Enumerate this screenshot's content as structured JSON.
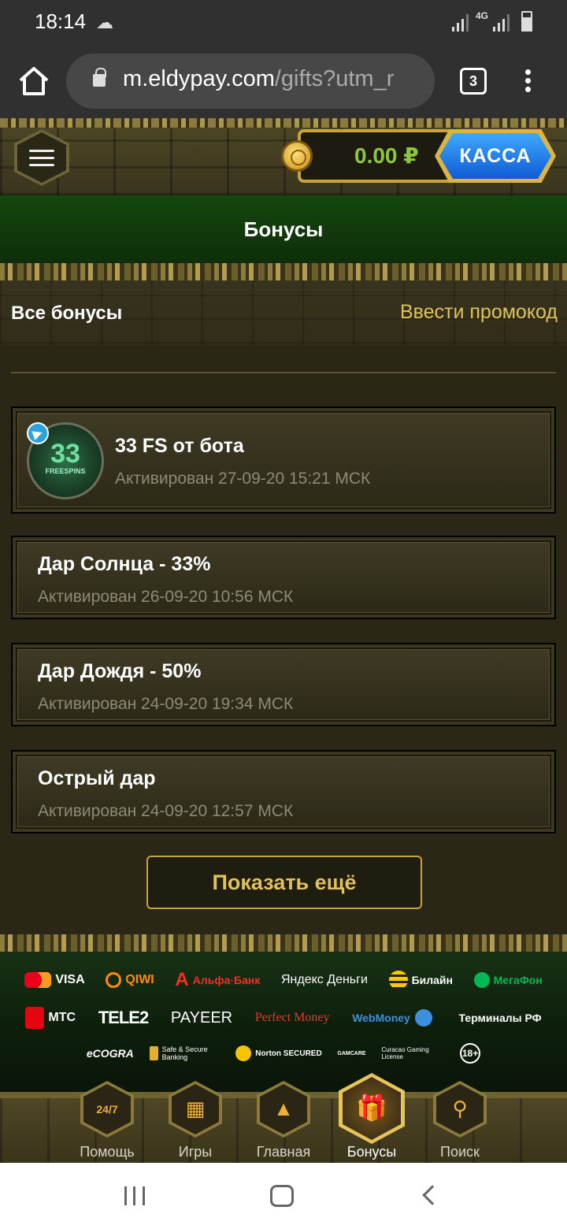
{
  "status_bar": {
    "time": "18:14",
    "network": "4G"
  },
  "browser": {
    "url_host": "m.eldypay.com",
    "url_path": "/gifts?utm_r",
    "tab_count": "3"
  },
  "header": {
    "balance": "0.00 ₽",
    "cashier_label": "КАССА"
  },
  "page": {
    "title": "Бонусы",
    "all_bonuses_label": "Все бонусы",
    "promo_link": "Ввести промокод"
  },
  "bonuses": [
    {
      "name": "33 FS от бота",
      "date": "Активирован 27-09-20 15:21 МСК",
      "image_number": "33",
      "image_caption": "FREESPINS"
    },
    {
      "name": "Дар Солнца - 33%",
      "date": "Активирован 26-09-20 10:56 МСК"
    },
    {
      "name": "Дар Дождя - 50%",
      "date": "Активирован 24-09-20 19:34 МСК"
    },
    {
      "name": "Острый дар",
      "date": "Активирован 24-09-20 12:57 МСК"
    }
  ],
  "show_more_label": "Показать ещё",
  "payments": {
    "row1": [
      "VISA",
      "QIWI",
      "Альфа·Банк",
      "Яндекс Деньги",
      "Билайн",
      "МегаФон"
    ],
    "row2": [
      "МТС",
      "TELE2",
      "PAYEER",
      "Perfect Money",
      "WebMoney",
      "Терминалы РФ"
    ],
    "row3": [
      "eCOGRA",
      "Safe & Secure Banking",
      "Norton SECURED",
      "GAMCARE",
      "Curacao Gaming License",
      "18+"
    ]
  },
  "nav": [
    {
      "label": "Помощь",
      "glyph": "24/7"
    },
    {
      "label": "Игры",
      "glyph": "▦"
    },
    {
      "label": "Главная",
      "glyph": "▲"
    },
    {
      "label": "Бонусы",
      "glyph": "🎁"
    },
    {
      "label": "Поиск",
      "glyph": "⚲"
    }
  ],
  "colors": {
    "accent_gold": "#e0c25b",
    "balance_green": "#8cc63f",
    "cashier_blue": "#1f7ae8"
  }
}
